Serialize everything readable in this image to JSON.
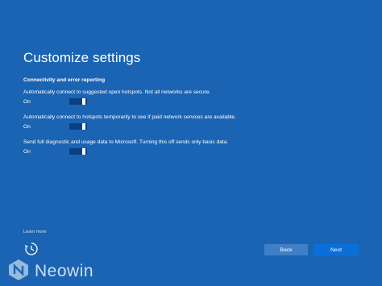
{
  "page": {
    "title": "Customize settings"
  },
  "section": {
    "heading": "Connectivity and error reporting"
  },
  "settings": [
    {
      "description": "Automatically connect to suggested open hotspots. Not all networks are secure.",
      "state_label": "On",
      "enabled": true
    },
    {
      "description": "Automatically connect to hotspots temporarily to see if paid network services are available.",
      "state_label": "On",
      "enabled": true
    },
    {
      "description": "Send full diagnostic and usage data to Microsoft. Turning this off sends only basic data.",
      "state_label": "On",
      "enabled": true
    }
  ],
  "footer": {
    "learn_more": "Learn more",
    "ease_icon": "ease-of-access-icon",
    "back_label": "Back",
    "next_label": "Next"
  },
  "watermark": {
    "logo_icon": "neowin-logo-icon",
    "text": "Neowin"
  },
  "colors": {
    "background": "#1b64b3",
    "toggle_track": "#0a3f86",
    "back_button": "#3f7fc7",
    "next_button": "#0b6fd9"
  }
}
